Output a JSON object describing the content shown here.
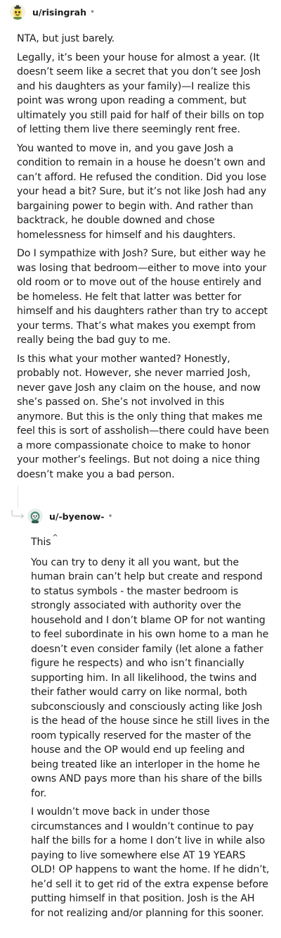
{
  "comment1": {
    "username": "u/risingrah",
    "separator": "•",
    "avatar_icon": "snoo-avatar-yellow-icon",
    "paragraphs": [
      "NTA, but just barely.",
      "Legally, it’s been your house for almost a year. (It doesn’t seem like a secret that you don’t see Josh and his daughters as your family)—I realize this point was wrong upon reading a comment, but ultimately you still paid for half of their bills on top of letting them live there seemingly rent free.",
      "You wanted to move in, and you gave Josh a condition to remain in a house he doesn’t own and can’t afford. He refused the condition. Did you lose your head a bit? Sure, but it’s not like Josh had any bargaining power to begin with. And rather than backtrack, he double downed and chose homelessness for himself and his daughters.",
      "Do I sympathize with Josh? Sure, but either way he was losing that bedroom—either to move into your old room or to move out of the house entirely and be homeless. He felt that latter was better for himself and his daughters rather than try to accept your terms. That’s what makes you exempt from really being the bad guy to me.",
      "Is this what your mother wanted? Honestly, probably not. However, she never married Josh, never gave Josh any claim on the house, and now she’s passed on. She’s not involved in this anymore. But this is the only thing that makes me feel this is sort of assholish—there could have been a more compassionate choice to make to honor your mother’s feelings. But not doing a nice thing doesn’t make you a bad person."
    ]
  },
  "comment2": {
    "username": "u/-byenow-",
    "separator": "•",
    "avatar_icon": "snoo-avatar-green-icon",
    "reply_icon": "reply-arrow-icon",
    "first_word": "This",
    "superscript": "^",
    "paragraphs": [
      "You can try to deny it all you want, but the human brain can’t help but create and respond to status symbols - the master bedroom is strongly associated with authority over the household and I don’t blame OP for not wanting to feel subordinate in his own home to a man he doesn’t even consider family (let alone a father figure he respects) and who isn’t financially supporting him. In all likelihood, the twins and their father would carry on like normal, both subconsciously and consciously acting like Josh is the head of the house since he still lives in the room typically reserved for the master of the house and the OP would end up feeling and being treated like an interloper in the home he owns AND pays more than his share of the bills for.",
      "I wouldn’t move back in under those circumstances and I wouldn’t continue to pay half the bills for a home I don’t live in while also paying to live somewhere else AT 19 YEARS OLD! OP happens to want the home. If he didn’t, he’d sell it to get rid of the extra expense before putting himself in that position. Josh is the AH for not realizing and/or planning for this sooner."
    ]
  }
}
